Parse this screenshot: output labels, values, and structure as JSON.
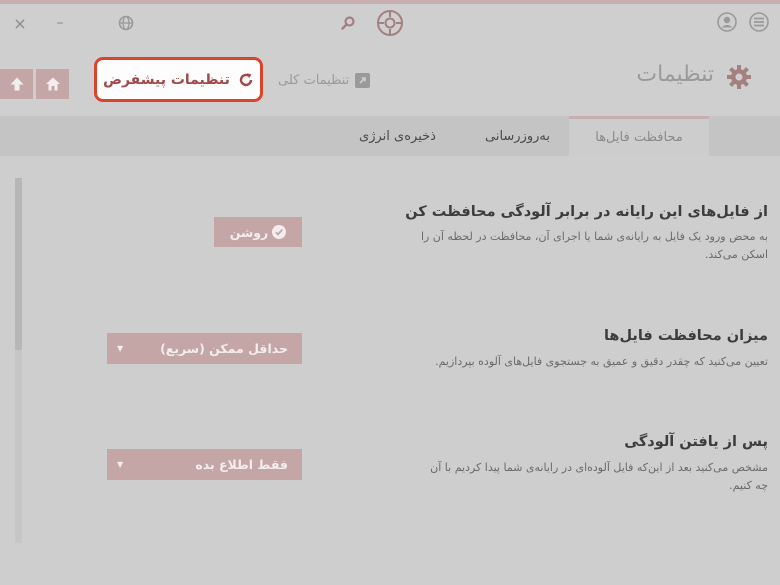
{
  "header": {
    "title": "تنظیمات",
    "general_settings": "تنظیمات کلی",
    "default_settings": "تنظیمات پیشفرض"
  },
  "tabs": [
    {
      "label": "محافظت فایل‌ها",
      "active": true
    },
    {
      "label": "به‌روزرسانی",
      "active": false
    },
    {
      "label": "ذخیره‌ی انرژی",
      "active": false
    }
  ],
  "sections": [
    {
      "title": "از فایل‌های این رایانه در برابر آلودگی محافظت کن",
      "desc_line1": "به محض ورود یک فایل به رایانه‌ی شما یا اجرای آن، محافظت در لحظه آن را",
      "desc_line2": "اسکن می‌کند.",
      "control_label": "روشن"
    },
    {
      "title": "میزان محافظت فایل‌ها",
      "desc_line1": "تعیین می‌کنید که چقدر دقیق و عمیق به جستجوی فایل‌های آلوده بپردازیم.",
      "control_label": "حداقل ممکن (سریع)"
    },
    {
      "title": "پس از یافتن آلودگی",
      "desc_line1": "مشخص می‌کنید بعد از این‌که فایل آلوده‌ای در رایانه‌ی شما پیدا کردیم با آن",
      "desc_line2": "چه کنیم.",
      "control_label": "فقط اطلاع بده"
    }
  ],
  "titlebar": {
    "close": "×",
    "minimize": "–"
  },
  "colors": {
    "accent": "#c4a6a6",
    "highlight_border": "#d9442a",
    "background": "#cfcfcf"
  },
  "icons": [
    "close-icon",
    "minimize-icon",
    "globe-icon",
    "search-icon",
    "crosshair-logo-icon",
    "user-icon",
    "menu-icon",
    "gear-icon",
    "external-link-icon",
    "refresh-icon",
    "home-icon",
    "up-arrow-icon",
    "check-icon",
    "chevron-down-icon"
  ]
}
